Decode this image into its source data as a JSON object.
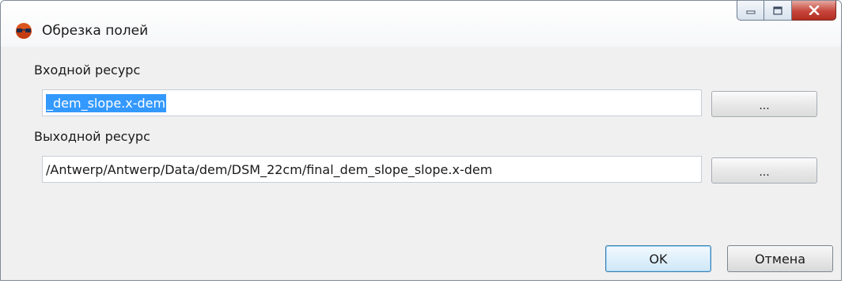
{
  "window": {
    "title": "Обрезка полей",
    "icon": "app-globe-glasses-icon",
    "controls": [
      "minimize-icon",
      "maximize-icon",
      "close-icon"
    ]
  },
  "input": {
    "label": "Входной ресурс",
    "value": "_dem_slope.x-dem",
    "browse_label": "..."
  },
  "output": {
    "label": "Выходной ресурс",
    "value": "/Antwerp/Antwerp/Data/dem/DSM_22cm/final_dem_slope_slope.x-dem",
    "browse_label": "..."
  },
  "buttons": {
    "ok": "OK",
    "cancel": "Отмена"
  },
  "colors": {
    "selection": "#3399ff",
    "close_button": "#c6453a",
    "dialog_bg": "#f0f0f0"
  }
}
